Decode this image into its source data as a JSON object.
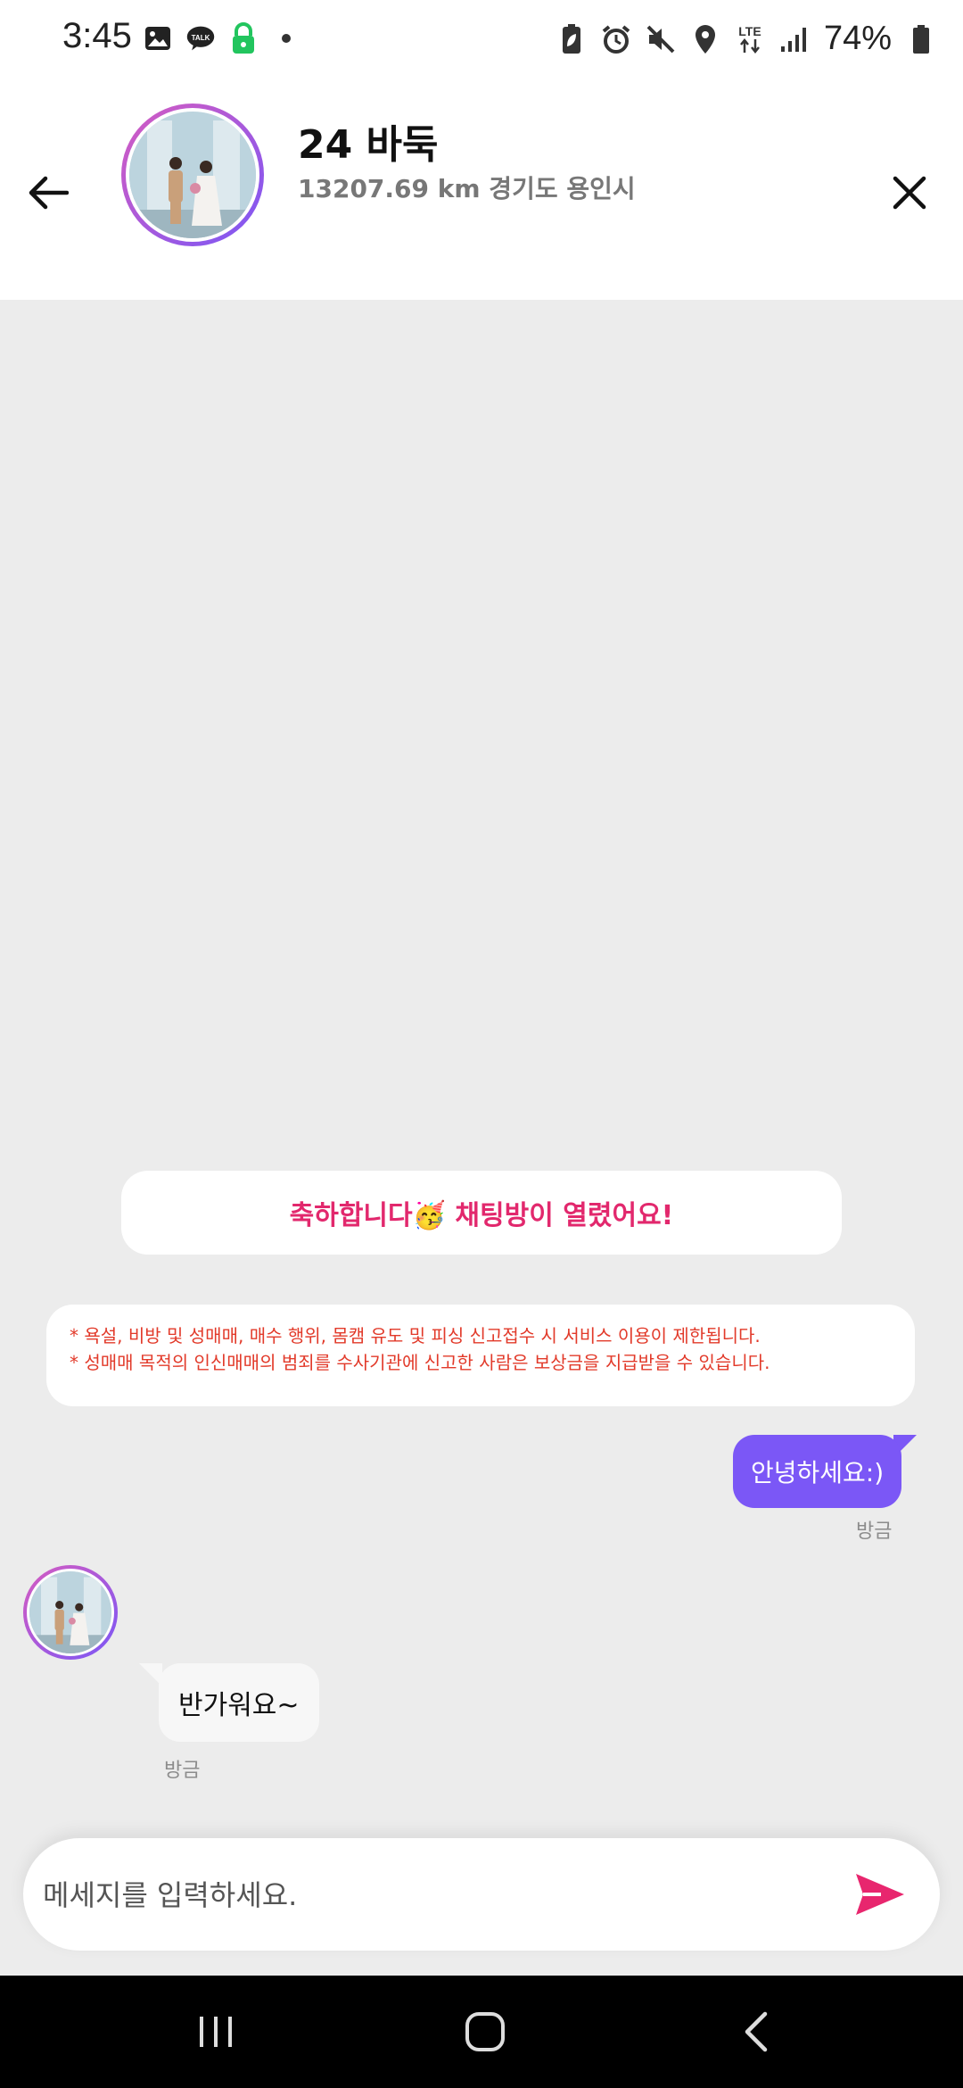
{
  "status_bar": {
    "time": "3:45",
    "battery_percent": "74%",
    "left_icons": [
      "image-icon",
      "kakaotalk-icon",
      "lock-icon",
      "dot-icon"
    ],
    "right_icons": [
      "battery-saver-icon",
      "alarm-icon",
      "mute-icon",
      "location-icon",
      "lte-icon",
      "signal-icon",
      "battery-icon"
    ]
  },
  "header": {
    "title": "24 바둑",
    "subtitle": "13207.69 km 경기도 용인시"
  },
  "chat": {
    "notice": "축하합니다🥳 채팅방이 열렸어요!",
    "warnings": [
      "* 욕설, 비방 및 성매매, 매수 행위, 몸캠 유도 및 피싱 신고접수 시 서비스 이용이 제한됩니다.",
      "* 성매매 목적의 인신매매의 범죄를 수사기관에 신고한 사람은 보상금을 지급받을 수 있습니다."
    ],
    "messages": [
      {
        "direction": "out",
        "text": "안녕하세요:)",
        "time": "방금"
      },
      {
        "direction": "in",
        "text": "반가워요~",
        "time": "방금"
      }
    ]
  },
  "input": {
    "placeholder": "메세지를 입력하세요."
  },
  "colors": {
    "accent": "#7b57f6",
    "notice_text": "#e2286d",
    "warning_text": "#e23a2a",
    "send_icon": "#e8266e"
  }
}
